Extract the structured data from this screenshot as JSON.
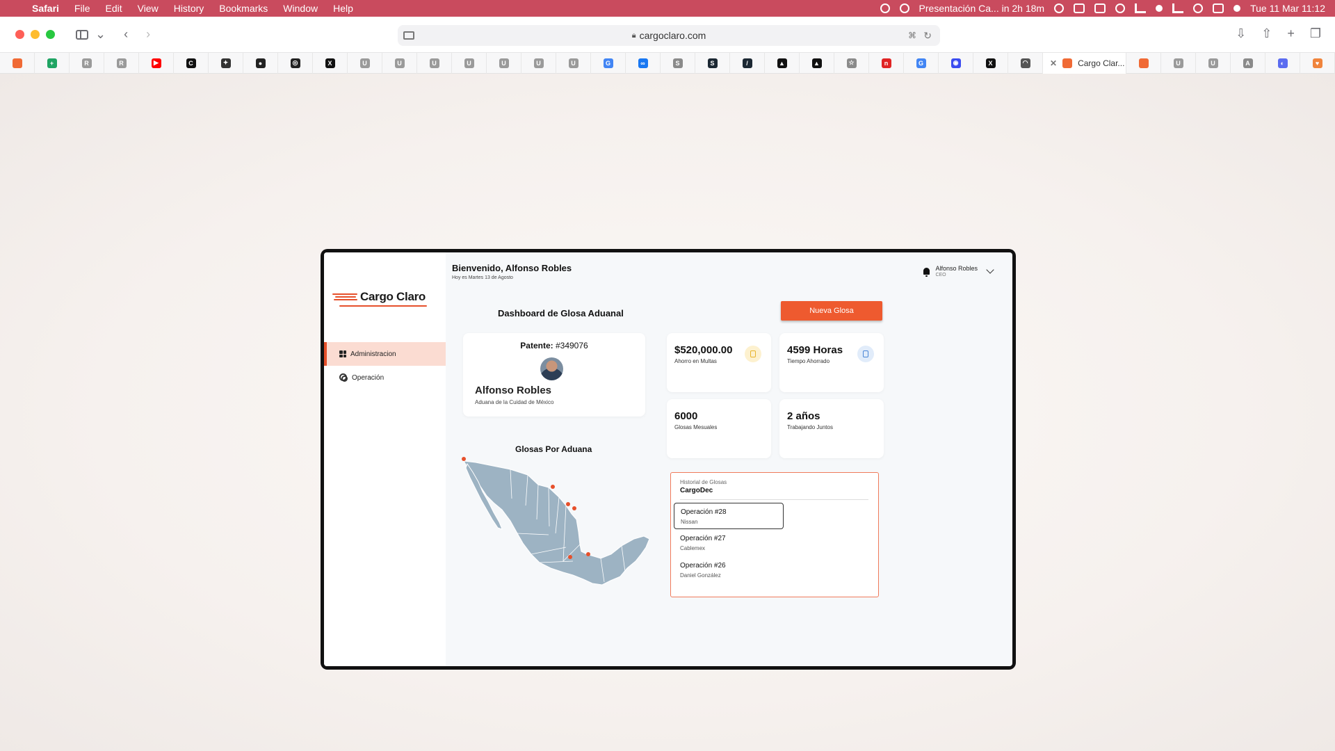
{
  "menubar": {
    "apple": "",
    "app_name": "Safari",
    "menus": [
      "File",
      "Edit",
      "View",
      "History",
      "Bookmarks",
      "Window",
      "Help"
    ],
    "event": "Presentación Ca... in 2h 18m",
    "datetime": "Tue 11 Mar  11:12"
  },
  "browser": {
    "url": "cargoclaro.com",
    "active_tab_title": "Cargo Clar...",
    "favorites": [
      {
        "letter": "",
        "color": "#f06a35"
      },
      {
        "letter": "+",
        "color": "#1fa463"
      },
      {
        "letter": "R",
        "color": "#9a9a9a"
      },
      {
        "letter": "R",
        "color": "#9a9a9a"
      },
      {
        "letter": "▶",
        "color": "#ff0000"
      },
      {
        "letter": "C",
        "color": "#111111"
      },
      {
        "letter": "✦",
        "color": "#333333"
      },
      {
        "letter": "●",
        "color": "#222222"
      },
      {
        "letter": "◎",
        "color": "#222222"
      },
      {
        "letter": "X",
        "color": "#111111"
      },
      {
        "letter": "U",
        "color": "#9a9a9a"
      },
      {
        "letter": "U",
        "color": "#9a9a9a"
      },
      {
        "letter": "U",
        "color": "#9a9a9a"
      },
      {
        "letter": "U",
        "color": "#9a9a9a"
      },
      {
        "letter": "U",
        "color": "#9a9a9a"
      },
      {
        "letter": "U",
        "color": "#9a9a9a"
      },
      {
        "letter": "U",
        "color": "#9a9a9a"
      },
      {
        "letter": "G",
        "color": "#4285f4"
      },
      {
        "letter": "∞",
        "color": "#1877f2"
      },
      {
        "letter": "S",
        "color": "#8a8a8a"
      },
      {
        "letter": "S",
        "color": "#1c2833"
      },
      {
        "letter": "/",
        "color": "#1c2833"
      },
      {
        "letter": "▲",
        "color": "#111111"
      },
      {
        "letter": "▲",
        "color": "#111111"
      },
      {
        "letter": "☆",
        "color": "#8a8a8a"
      },
      {
        "letter": "n",
        "color": "#e02424"
      },
      {
        "letter": "G",
        "color": "#4285f4"
      },
      {
        "letter": "◉",
        "color": "#3b4cf0"
      },
      {
        "letter": "X",
        "color": "#111111"
      },
      {
        "letter": "◠",
        "color": "#555555"
      }
    ],
    "favorites_after": [
      {
        "letter": "",
        "color": "#f06a35"
      },
      {
        "letter": "U",
        "color": "#9a9a9a"
      },
      {
        "letter": "U",
        "color": "#9a9a9a"
      },
      {
        "letter": "A",
        "color": "#8a8a8a"
      },
      {
        "letter": "◐",
        "color": "#5b6cf0"
      },
      {
        "letter": "♥",
        "color": "#f0843c"
      }
    ]
  },
  "app": {
    "brand": "Cargo Claro",
    "accent_color": "#ee5a2f",
    "nav": [
      {
        "label": "Administracion",
        "icon": "grid-icon",
        "active": true
      },
      {
        "label": "Operación",
        "icon": "gears-icon",
        "active": false
      }
    ],
    "welcome_title": "Bienvenido, Alfonso Robles",
    "welcome_date": "Hoy es Martes 13 de Agosto",
    "user": {
      "name": "Alfonso Robles",
      "role": "CEO"
    },
    "dashboard_title": "Dashboard de Glosa Aduanal",
    "new_button": "Nueva Glosa",
    "patente": {
      "label": "Patente:",
      "number": "#349076",
      "name": "Alfonso Robles",
      "aduana": "Aduana de la Cuidad de México"
    },
    "stats": [
      {
        "value": "$520,000.00",
        "label": "Ahorro en Multas",
        "icon": "coin-icon"
      },
      {
        "value": "4599 Horas",
        "label": "Tiempo Ahorrado",
        "icon": "clock-icon"
      },
      {
        "value": "6000",
        "label": "Glosas Mesuales"
      },
      {
        "value": "2 años",
        "label": "Trabajando Juntos"
      }
    ],
    "map_title": "Glosas Por Aduana",
    "historial": {
      "title": "Historial de Glosas",
      "subtitle": "CargoDec",
      "operations": [
        {
          "title": "Operación #28",
          "client": "Nissan"
        },
        {
          "title": "Operación #27",
          "client": "Cablemex"
        },
        {
          "title": "Operación #26",
          "client": "Daniel González"
        }
      ]
    }
  }
}
